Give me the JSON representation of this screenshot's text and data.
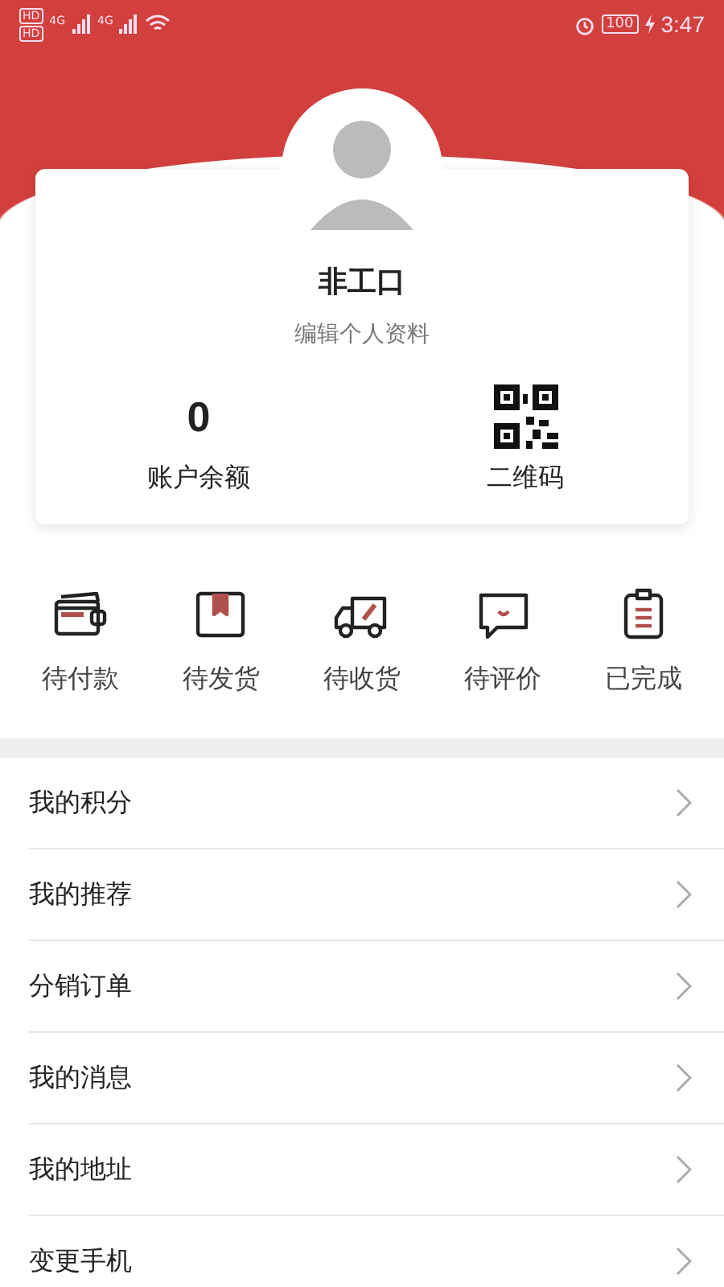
{
  "status_bar": {
    "sim_labels": [
      "HD",
      "HD"
    ],
    "networks": [
      "4G",
      "4G"
    ],
    "battery": "100",
    "time": "3:47"
  },
  "profile": {
    "name": "非工口",
    "edit_link": "编辑个人资料",
    "balance": {
      "value": "0",
      "label": "账户余额"
    },
    "qr": {
      "label": "二维码"
    }
  },
  "orders": [
    {
      "kind": "wallet",
      "label": "待付款"
    },
    {
      "kind": "box",
      "label": "待发货"
    },
    {
      "kind": "truck",
      "label": "待收货"
    },
    {
      "kind": "chat",
      "label": "待评价"
    },
    {
      "kind": "clipboard",
      "label": "已完成"
    }
  ],
  "menu": [
    "我的积分",
    "我的推荐",
    "分销订单",
    "我的消息",
    "我的地址",
    "变更手机"
  ]
}
